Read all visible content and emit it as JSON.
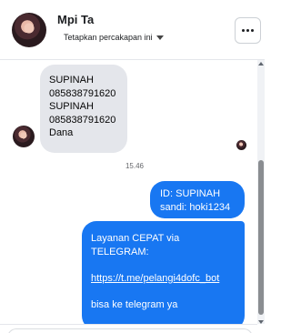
{
  "header": {
    "contact_name": "Mpi Ta",
    "pin_label": "Tetapkan percakapan ini",
    "caret_icon": "caret-down-icon",
    "more_icon": "more-horizontal-icon"
  },
  "messages": {
    "incoming": {
      "lines": [
        "SUPINAH",
        "085838791620",
        "SUPINAH",
        "085838791620",
        "Dana"
      ]
    },
    "timestamp": "15.46",
    "outgoing_1": {
      "line1": "ID: SUPINAH",
      "line2": "sandi: hoki1234"
    },
    "outgoing_2": {
      "line1": "Layanan CEPAT via",
      "line2": "TELEGRAM:",
      "link": "https://t.me/pelangi4dofc_bot",
      "line3": "bisa ke telegram ya"
    }
  },
  "colors": {
    "outgoing_bubble": "#1877f2",
    "incoming_bubble": "#e4e6eb"
  }
}
